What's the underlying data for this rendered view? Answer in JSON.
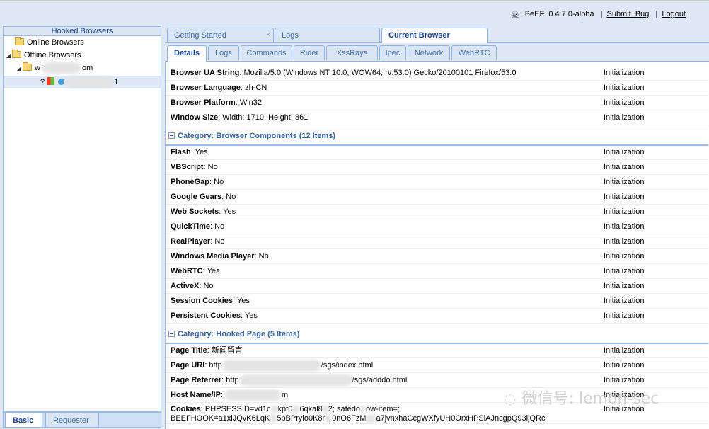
{
  "header": {
    "app_name": "BeEF",
    "version": "0.4.7.0-alpha",
    "submit_bug": "Submit_Bug",
    "logout": "Logout",
    "separator": "|"
  },
  "left_panel": {
    "title": "Hooked Browsers",
    "online": "Online Browsers",
    "offline": "Offline Browsers",
    "host_prefix": "w",
    "host_suffix": "om",
    "browser_prefix": "?",
    "browser_suffix": "1"
  },
  "left_tabs": [
    "Basic",
    "Requester"
  ],
  "main_tabs": [
    "Getting Started",
    "Logs",
    "Current Browser"
  ],
  "close_glyph": "×",
  "sub_tabs": [
    "Details",
    "Logs",
    "Commands",
    "Rider",
    "XssRays",
    "Ipec",
    "Network",
    "WebRTC"
  ],
  "status": "Initialization",
  "rows_top": [
    {
      "k": "Browser UA String",
      "v": "Mozilla/5.0 (Windows NT 10.0; WOW64; rv:53.0) Gecko/20100101 Firefox/53.0"
    },
    {
      "k": "Browser Language",
      "v": "zh-CN"
    },
    {
      "k": "Browser Platform",
      "v": "Win32"
    },
    {
      "k": "Window Size",
      "v": "Width: 1710, Height: 861"
    }
  ],
  "category_components": "Category: Browser Components (12 Items)",
  "rows_components": [
    {
      "k": "Flash",
      "v": "Yes"
    },
    {
      "k": "VBScript",
      "v": "No"
    },
    {
      "k": "PhoneGap",
      "v": "No"
    },
    {
      "k": "Google Gears",
      "v": "No"
    },
    {
      "k": "Web Sockets",
      "v": "Yes"
    },
    {
      "k": "QuickTime",
      "v": "No"
    },
    {
      "k": "RealPlayer",
      "v": "No"
    },
    {
      "k": "Windows Media Player",
      "v": "No"
    },
    {
      "k": "WebRTC",
      "v": "Yes"
    },
    {
      "k": "ActiveX",
      "v": "No"
    },
    {
      "k": "Session Cookies",
      "v": "Yes"
    },
    {
      "k": "Persistent Cookies",
      "v": "Yes"
    }
  ],
  "category_page": "Category: Hooked Page (5 Items)",
  "rows_page": [
    {
      "k": "Page Title",
      "v": "新闻留言"
    },
    {
      "k": "Page URI",
      "v": "http",
      "tail": "/sgs/index.html"
    },
    {
      "k": "Page Referrer",
      "v": "http",
      "tail": "/sgs/adddo.html"
    },
    {
      "k": "Host Name/IP",
      "v": "",
      "tail": "m"
    },
    {
      "k": "Cookies",
      "v": "PHPSESSID=vd1c",
      "mid": "kpf0",
      "mid2": "6qkal8",
      "mid3": "2; safedo",
      "mid4": "ow-item=;",
      "line2a": "BEEFHOOK=a1xiJQvK6LqK",
      "line2b": "5pBPryio0K8r",
      "line2c": "0nO6FzM",
      "line2d": "a7jvnxhaCcgWXfyUH0OrxHPSiAJncgpQ93ijQRc"
    }
  ],
  "watermark": "微信号: lemon-sec"
}
